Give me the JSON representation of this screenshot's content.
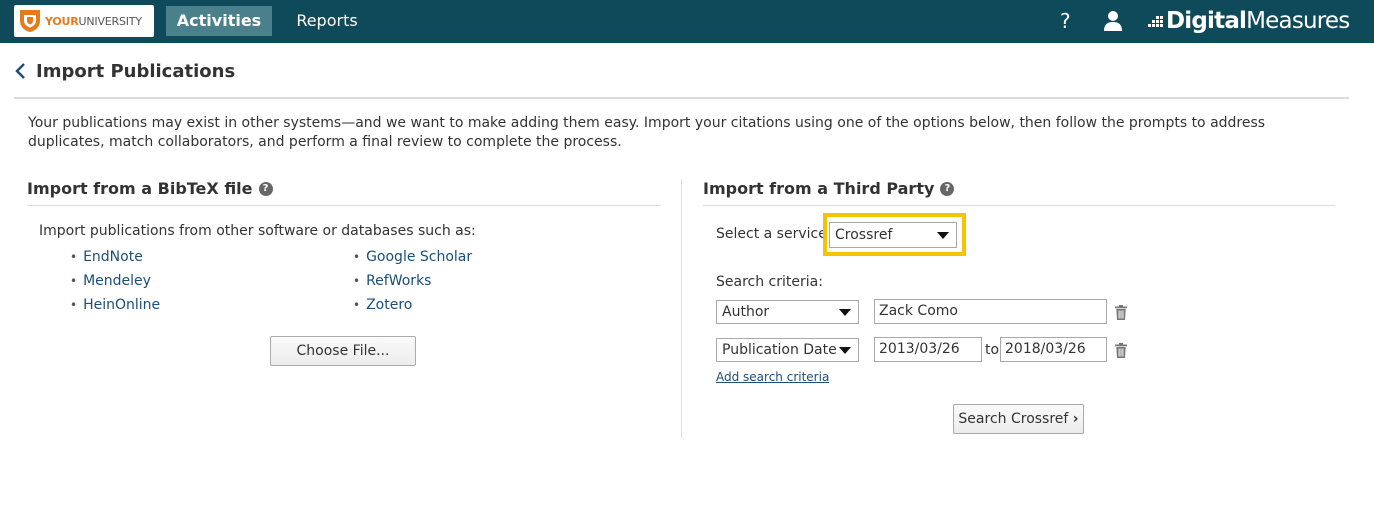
{
  "topbar": {
    "logo": {
      "text_highlight": "YOUR",
      "text_rest": "UNIVERSITY",
      "icon": "shield-logo-icon"
    },
    "nav": [
      {
        "label": "Activities",
        "active": true
      },
      {
        "label": "Reports",
        "active": false
      }
    ],
    "help_label": "?",
    "brand": {
      "bold": "Digital",
      "regular": "Measures"
    },
    "colors": {
      "bar": "#0f4a5a",
      "active_tab": "#4a7f8c",
      "logo_accent": "#e47b1e"
    }
  },
  "page": {
    "title": "Import Publications",
    "intro": "Your publications may exist in other systems—and we want to make adding them easy. Import your citations using one of the options below, then follow the prompts to address duplicates, match collaborators, and perform a final review to complete the process."
  },
  "bibtex": {
    "title": "Import from a BibTeX file",
    "intro": "Import publications from other software or databases such as:",
    "sources": [
      "EndNote",
      "Mendeley",
      "HeinOnline",
      "Google Scholar",
      "RefWorks",
      "Zotero"
    ],
    "button": "Choose File..."
  },
  "third_party": {
    "title": "Import from a Third Party",
    "service_label": "Select a service",
    "service_value": "Crossref",
    "criteria_label": "Search criteria:",
    "criteria": [
      {
        "field": "Author",
        "value": "Zack Como"
      },
      {
        "field": "Publication Date",
        "from": "2013/03/26",
        "to_label": "to",
        "to": "2018/03/26"
      }
    ],
    "add_link": "Add search criteria",
    "search_button": "Search Crossref",
    "search_button_arrow": "›",
    "highlight_color": "#f5c400"
  },
  "link_color": "#1b4e78"
}
